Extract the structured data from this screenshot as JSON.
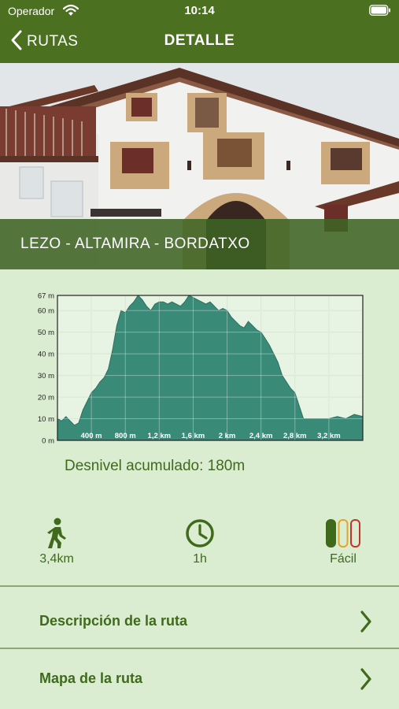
{
  "status_bar": {
    "carrier": "Operador",
    "time": "10:14"
  },
  "nav": {
    "back_label": "RUTAS",
    "title": "DETALLE"
  },
  "route": {
    "name": "LEZO - ALTAMIRA - BORDATXO"
  },
  "colors": {
    "accent": "#4a7020",
    "background": "#dbedd1",
    "profile_fill": "#3a8a78",
    "text": "#3f6a1c"
  },
  "chart_data": {
    "type": "area",
    "title": "",
    "xlabel": "",
    "ylabel": "",
    "x_unit": "km",
    "y_unit": "m",
    "xlim": [
      0,
      3.6
    ],
    "ylim": [
      0,
      67
    ],
    "grid": true,
    "x_ticks": [
      0.4,
      0.8,
      1.2,
      1.6,
      2.0,
      2.4,
      2.8,
      3.2
    ],
    "x_tick_labels": [
      "400 m",
      "800 m",
      "1,2 km",
      "1,6 km",
      "2 km",
      "2,4 km",
      "2,8 km",
      "3,2 km"
    ],
    "y_ticks": [
      0,
      10,
      20,
      30,
      40,
      50,
      60,
      67
    ],
    "y_tick_labels": [
      "0 m",
      "10 m",
      "20 m",
      "30 m",
      "40 m",
      "50 m",
      "60 m",
      "67 m"
    ],
    "x": [
      0,
      0.05,
      0.1,
      0.15,
      0.2,
      0.25,
      0.3,
      0.35,
      0.4,
      0.45,
      0.5,
      0.55,
      0.6,
      0.65,
      0.7,
      0.75,
      0.8,
      0.85,
      0.9,
      0.95,
      1.0,
      1.05,
      1.1,
      1.15,
      1.2,
      1.25,
      1.3,
      1.35,
      1.4,
      1.45,
      1.5,
      1.55,
      1.6,
      1.65,
      1.7,
      1.75,
      1.8,
      1.85,
      1.9,
      1.95,
      2.0,
      2.05,
      2.1,
      2.15,
      2.2,
      2.25,
      2.3,
      2.35,
      2.4,
      2.45,
      2.5,
      2.55,
      2.6,
      2.65,
      2.7,
      2.75,
      2.8,
      2.85,
      2.9,
      2.95,
      3.0,
      3.1,
      3.2,
      3.3,
      3.4,
      3.5,
      3.6
    ],
    "y": [
      10,
      9,
      11,
      9,
      7,
      8,
      14,
      18,
      22,
      24,
      27,
      29,
      33,
      42,
      53,
      60,
      59,
      62,
      64,
      67,
      65,
      62,
      60,
      63,
      64,
      64,
      63,
      64,
      63,
      62,
      64,
      67,
      66,
      65,
      64,
      63,
      64,
      62,
      60,
      61,
      60,
      57,
      55,
      53,
      52,
      55,
      53,
      51,
      50,
      47,
      44,
      40,
      36,
      30,
      27,
      24,
      22,
      16,
      10,
      10,
      10,
      10,
      10,
      11,
      10,
      12,
      11
    ]
  },
  "elevation": {
    "label": "Desnivel acumulado:",
    "value": "180m"
  },
  "stats": {
    "distance": "3,4km",
    "duration": "1h",
    "difficulty": "Fácil"
  },
  "menu": {
    "description_label": "Descripción de la ruta",
    "map_label": "Mapa de la ruta"
  }
}
